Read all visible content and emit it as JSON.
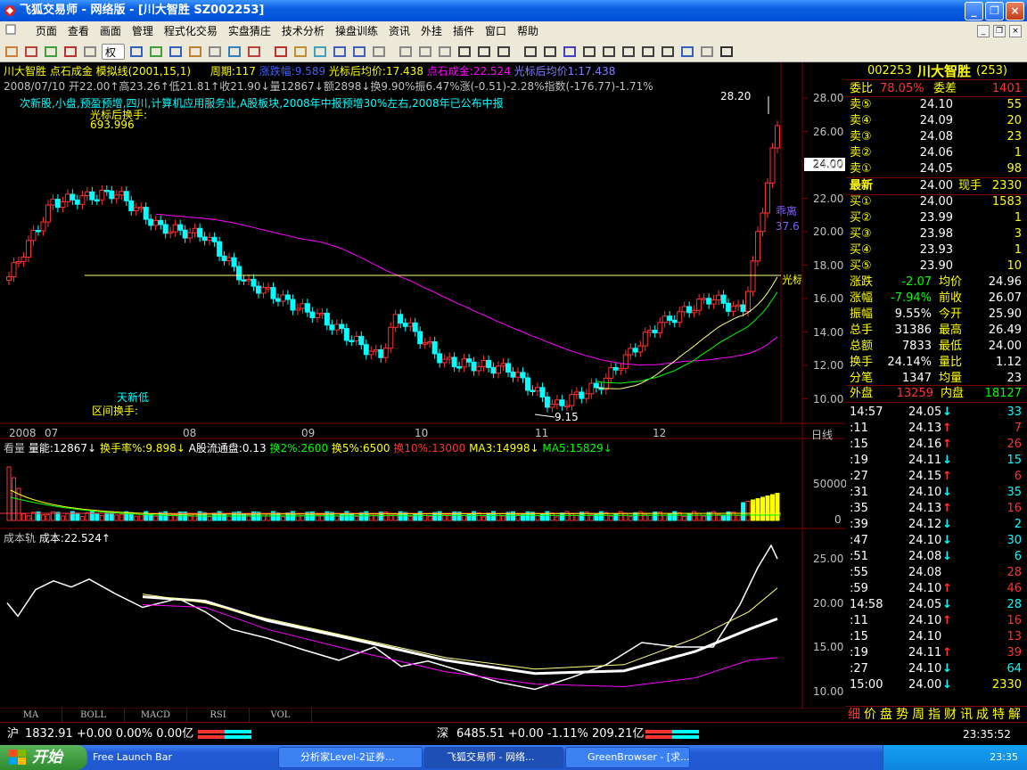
{
  "window": {
    "title": "飞狐交易师 - 网络版 - [川大智胜 SZ002253]",
    "buttons": [
      "_",
      "❐",
      "×"
    ]
  },
  "menu": [
    "页面",
    "查看",
    "画面",
    "管理",
    "程式化交易",
    "实盘猜庄",
    "技术分析",
    "操盘训练",
    "资讯",
    "外挂",
    "插件",
    "窗口",
    "帮助"
  ],
  "toolbar": {
    "weight_label": "权"
  },
  "main_chart": {
    "line1": "川大智胜 点石成金 模拟线(2001,15,1)",
    "period": "周期:117",
    "rise": "涨跌幅:9.589",
    "cursor_avg": "光标后均价:17.438",
    "dianshi": "点石成金:22.524",
    "cursor_avg2": "光标后均价1:17.438",
    "info": "2008/07/10 开22.00↑高23.26↑低21.81↑收21.90↓量12867↓额2898↓换9.90%振6.47%涨(-0.51)-2.28%指数(-176.77)-1.71%",
    "note": "次新股,小盘,预盈预增,四川,计算机应用服务业,A股板块,2008年中报预增30%左右,2008年已公布中报",
    "turnover_label": "光标后换手:",
    "turnover_value": "693.996",
    "new_low": "天新低",
    "range_turnover": "区间换手:",
    "high_label": "28.20",
    "low_label": "9.15",
    "last_price_tag": "24.00",
    "deviation_label": "乖离",
    "deviation_value": "37.6",
    "cursor_line_label": "光标",
    "y_ticks": [
      "28.00",
      "26.00",
      "24.00",
      "22.00",
      "20.00",
      "18.00",
      "16.00",
      "14.00",
      "12.00",
      "10.00"
    ],
    "x_ticks": [
      "2008",
      "07",
      "08",
      "09",
      "10",
      "11",
      "12"
    ],
    "daily_label": "日线",
    "colors": {
      "up": "#ff3232",
      "down": "#00ffff",
      "ma_long": "#ff00ff",
      "ma1": "#ffff80",
      "ma2": "#00ff00"
    }
  },
  "volume_chart": {
    "title": "看量",
    "vol": "量能:12867↓",
    "turn": "换手率%:9.898↓",
    "float": "A股流通盘:0.13",
    "h2": "换2%:2600",
    "h5": "换5%:6500",
    "h10": "换10%:13000",
    "ma3": "MA3:14998↓",
    "ma5": "MA5:15829↓",
    "y_ticks": [
      "50000",
      "0"
    ]
  },
  "cost_chart": {
    "title": "成本轨",
    "cost": "成本:22.524↑",
    "y_ticks": [
      "25.00",
      "20.00",
      "15.00",
      "10.00"
    ]
  },
  "bottom_tabs": [
    "MA",
    "BOLL",
    "MACD",
    "RSI",
    "VOL"
  ],
  "quote": {
    "code": "002253",
    "name": "川大智胜",
    "count": "(253)",
    "weibi_label": "委比",
    "weibi": "78.05%",
    "weicha_label": "委差",
    "weicha": "1401",
    "asks": [
      {
        "label": "卖⑤",
        "price": "24.10",
        "vol": "55"
      },
      {
        "label": "卖④",
        "price": "24.09",
        "vol": "20"
      },
      {
        "label": "卖③",
        "price": "24.08",
        "vol": "23"
      },
      {
        "label": "卖②",
        "price": "24.06",
        "vol": "1"
      },
      {
        "label": "卖①",
        "price": "24.05",
        "vol": "98"
      }
    ],
    "latest_label": "最新",
    "latest": "24.00",
    "xianshou_label": "现手",
    "xianshou": "2330",
    "bids": [
      {
        "label": "买①",
        "price": "24.00",
        "vol": "1583"
      },
      {
        "label": "买②",
        "price": "23.99",
        "vol": "1"
      },
      {
        "label": "买③",
        "price": "23.98",
        "vol": "3"
      },
      {
        "label": "买④",
        "price": "23.93",
        "vol": "1"
      },
      {
        "label": "买⑤",
        "price": "23.90",
        "vol": "10"
      }
    ],
    "stats": [
      {
        "l1": "涨跌",
        "v1": "-2.07",
        "l2": "均价",
        "v2": "24.96"
      },
      {
        "l1": "涨幅",
        "v1": "-7.94%",
        "l2": "前收",
        "v2": "26.07"
      },
      {
        "l1": "振幅",
        "v1": "9.55%",
        "l2": "今开",
        "v2": "25.90"
      },
      {
        "l1": "总手",
        "v1": "31386",
        "l2": "最高",
        "v2": "26.49"
      },
      {
        "l1": "总额",
        "v1": "7833",
        "l2": "最低",
        "v2": "24.00"
      },
      {
        "l1": "换手",
        "v1": "24.14%",
        "l2": "量比",
        "v2": "1.12"
      },
      {
        "l1": "分笔",
        "v1": "1347",
        "l2": "均量",
        "v2": "23"
      }
    ],
    "waipan_label": "外盘",
    "waipan": "13259",
    "neipan_label": "内盘",
    "neipan": "18127",
    "ticks": [
      {
        "t": "14:57",
        "p": "24.05",
        "d": "down",
        "v": "33"
      },
      {
        "t": ":11",
        "p": "24.13",
        "d": "up",
        "v": "7"
      },
      {
        "t": ":15",
        "p": "24.16",
        "d": "up",
        "v": "26"
      },
      {
        "t": ":19",
        "p": "24.11",
        "d": "down",
        "v": "15"
      },
      {
        "t": ":27",
        "p": "24.15",
        "d": "up",
        "v": "6"
      },
      {
        "t": ":31",
        "p": "24.10",
        "d": "down",
        "v": "35"
      },
      {
        "t": ":35",
        "p": "24.13",
        "d": "up",
        "v": "16"
      },
      {
        "t": ":39",
        "p": "24.12",
        "d": "down",
        "v": "2"
      },
      {
        "t": ":47",
        "p": "24.10",
        "d": "down",
        "v": "30"
      },
      {
        "t": ":51",
        "p": "24.08",
        "d": "down",
        "v": "6"
      },
      {
        "t": ":55",
        "p": "24.08",
        "d": "",
        "v": "28"
      },
      {
        "t": ":59",
        "p": "24.10",
        "d": "up",
        "v": "46"
      },
      {
        "t": "14:58",
        "p": "24.05",
        "d": "down",
        "v": "28"
      },
      {
        "t": ":11",
        "p": "24.10",
        "d": "up",
        "v": "16"
      },
      {
        "t": ":15",
        "p": "24.10",
        "d": "",
        "v": "13"
      },
      {
        "t": ":19",
        "p": "24.11",
        "d": "up",
        "v": "39"
      },
      {
        "t": ":27",
        "p": "24.10",
        "d": "down",
        "v": "64"
      },
      {
        "t": "15:00",
        "p": "24.00",
        "d": "down",
        "v": "2330"
      }
    ],
    "tabs": [
      "细",
      "价",
      "盘",
      "势",
      "周",
      "指",
      "财",
      "讯",
      "成",
      "特",
      "解"
    ]
  },
  "status": {
    "sh_label": "沪",
    "sh": "1832.91 +0.00 0.00% 0.00亿",
    "sz_label": "深",
    "sz": "6485.51 +0.00 -1.11% 209.21亿",
    "time": "23:35:52"
  },
  "taskbar": {
    "start": "开始",
    "items": [
      "Free Launch Bar",
      "分析家Level-2证券...",
      "飞狐交易师 - 网络...",
      "GreenBrowser - [求..."
    ],
    "clock": "23:35"
  }
}
